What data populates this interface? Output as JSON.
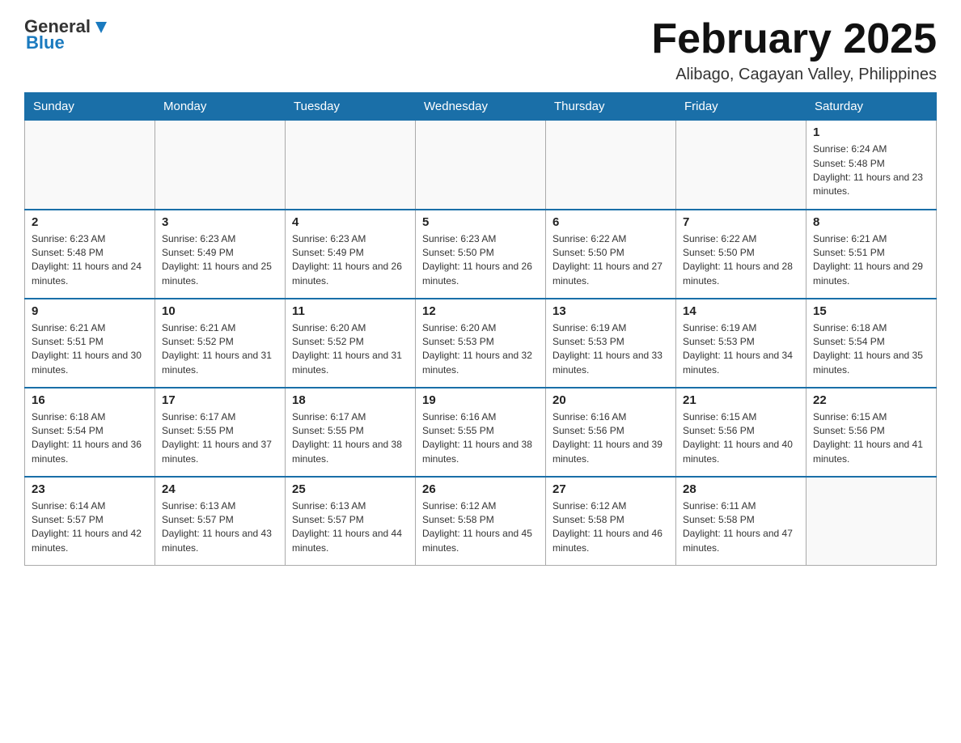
{
  "header": {
    "logo": {
      "general": "General",
      "blue": "Blue"
    },
    "title": "February 2025",
    "location": "Alibago, Cagayan Valley, Philippines"
  },
  "weekdays": [
    "Sunday",
    "Monday",
    "Tuesday",
    "Wednesday",
    "Thursday",
    "Friday",
    "Saturday"
  ],
  "weeks": [
    [
      {
        "day": "",
        "info": ""
      },
      {
        "day": "",
        "info": ""
      },
      {
        "day": "",
        "info": ""
      },
      {
        "day": "",
        "info": ""
      },
      {
        "day": "",
        "info": ""
      },
      {
        "day": "",
        "info": ""
      },
      {
        "day": "1",
        "info": "Sunrise: 6:24 AM\nSunset: 5:48 PM\nDaylight: 11 hours and 23 minutes."
      }
    ],
    [
      {
        "day": "2",
        "info": "Sunrise: 6:23 AM\nSunset: 5:48 PM\nDaylight: 11 hours and 24 minutes."
      },
      {
        "day": "3",
        "info": "Sunrise: 6:23 AM\nSunset: 5:49 PM\nDaylight: 11 hours and 25 minutes."
      },
      {
        "day": "4",
        "info": "Sunrise: 6:23 AM\nSunset: 5:49 PM\nDaylight: 11 hours and 26 minutes."
      },
      {
        "day": "5",
        "info": "Sunrise: 6:23 AM\nSunset: 5:50 PM\nDaylight: 11 hours and 26 minutes."
      },
      {
        "day": "6",
        "info": "Sunrise: 6:22 AM\nSunset: 5:50 PM\nDaylight: 11 hours and 27 minutes."
      },
      {
        "day": "7",
        "info": "Sunrise: 6:22 AM\nSunset: 5:50 PM\nDaylight: 11 hours and 28 minutes."
      },
      {
        "day": "8",
        "info": "Sunrise: 6:21 AM\nSunset: 5:51 PM\nDaylight: 11 hours and 29 minutes."
      }
    ],
    [
      {
        "day": "9",
        "info": "Sunrise: 6:21 AM\nSunset: 5:51 PM\nDaylight: 11 hours and 30 minutes."
      },
      {
        "day": "10",
        "info": "Sunrise: 6:21 AM\nSunset: 5:52 PM\nDaylight: 11 hours and 31 minutes."
      },
      {
        "day": "11",
        "info": "Sunrise: 6:20 AM\nSunset: 5:52 PM\nDaylight: 11 hours and 31 minutes."
      },
      {
        "day": "12",
        "info": "Sunrise: 6:20 AM\nSunset: 5:53 PM\nDaylight: 11 hours and 32 minutes."
      },
      {
        "day": "13",
        "info": "Sunrise: 6:19 AM\nSunset: 5:53 PM\nDaylight: 11 hours and 33 minutes."
      },
      {
        "day": "14",
        "info": "Sunrise: 6:19 AM\nSunset: 5:53 PM\nDaylight: 11 hours and 34 minutes."
      },
      {
        "day": "15",
        "info": "Sunrise: 6:18 AM\nSunset: 5:54 PM\nDaylight: 11 hours and 35 minutes."
      }
    ],
    [
      {
        "day": "16",
        "info": "Sunrise: 6:18 AM\nSunset: 5:54 PM\nDaylight: 11 hours and 36 minutes."
      },
      {
        "day": "17",
        "info": "Sunrise: 6:17 AM\nSunset: 5:55 PM\nDaylight: 11 hours and 37 minutes."
      },
      {
        "day": "18",
        "info": "Sunrise: 6:17 AM\nSunset: 5:55 PM\nDaylight: 11 hours and 38 minutes."
      },
      {
        "day": "19",
        "info": "Sunrise: 6:16 AM\nSunset: 5:55 PM\nDaylight: 11 hours and 38 minutes."
      },
      {
        "day": "20",
        "info": "Sunrise: 6:16 AM\nSunset: 5:56 PM\nDaylight: 11 hours and 39 minutes."
      },
      {
        "day": "21",
        "info": "Sunrise: 6:15 AM\nSunset: 5:56 PM\nDaylight: 11 hours and 40 minutes."
      },
      {
        "day": "22",
        "info": "Sunrise: 6:15 AM\nSunset: 5:56 PM\nDaylight: 11 hours and 41 minutes."
      }
    ],
    [
      {
        "day": "23",
        "info": "Sunrise: 6:14 AM\nSunset: 5:57 PM\nDaylight: 11 hours and 42 minutes."
      },
      {
        "day": "24",
        "info": "Sunrise: 6:13 AM\nSunset: 5:57 PM\nDaylight: 11 hours and 43 minutes."
      },
      {
        "day": "25",
        "info": "Sunrise: 6:13 AM\nSunset: 5:57 PM\nDaylight: 11 hours and 44 minutes."
      },
      {
        "day": "26",
        "info": "Sunrise: 6:12 AM\nSunset: 5:58 PM\nDaylight: 11 hours and 45 minutes."
      },
      {
        "day": "27",
        "info": "Sunrise: 6:12 AM\nSunset: 5:58 PM\nDaylight: 11 hours and 46 minutes."
      },
      {
        "day": "28",
        "info": "Sunrise: 6:11 AM\nSunset: 5:58 PM\nDaylight: 11 hours and 47 minutes."
      },
      {
        "day": "",
        "info": ""
      }
    ]
  ]
}
